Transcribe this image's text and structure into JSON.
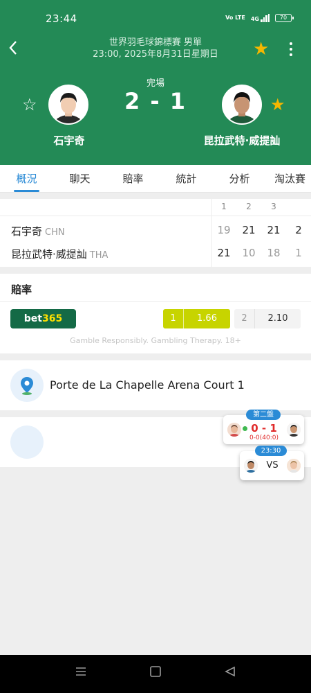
{
  "statusbar": {
    "time": "23:44",
    "net1": "Vo LTE",
    "net2": "4G",
    "battery": "70"
  },
  "header": {
    "competition": "世界羽毛球錦標賽 男單",
    "datetime": "23:00, 2025年8月31日星期日",
    "status": "完場",
    "score": "2 - 1",
    "player1": {
      "name": "石宇奇",
      "favorited": false
    },
    "player2": {
      "name": "昆拉武特·威提訕",
      "favorited": true
    },
    "match_favorited": true
  },
  "tabs": [
    "概況",
    "聊天",
    "賠率",
    "統計",
    "分析",
    "淘汰賽"
  ],
  "active_tab": 0,
  "scoreboard": {
    "set_headers": [
      "1",
      "2",
      "3"
    ],
    "rows": [
      {
        "name": "石宇奇",
        "country": "CHN",
        "sets": [
          "19",
          "21",
          "21"
        ],
        "total": "2"
      },
      {
        "name": "昆拉武特·威提訕",
        "country": "THA",
        "sets": [
          "21",
          "10",
          "18"
        ],
        "total": "1"
      }
    ]
  },
  "odds": {
    "title": "賠率",
    "bookmaker_a": "bet",
    "bookmaker_b": "365",
    "home_key": "1",
    "home_value": "1.66",
    "away_key": "2",
    "away_value": "2.10",
    "disclaimer": "Gamble Responsibly. Gambling Therapy. 18+"
  },
  "venue": {
    "name": "Porte de La Chapelle Arena Court 1"
  },
  "mini_live": {
    "tag": "第二盤",
    "score": "0 - 1",
    "sub": "0-0(40:0)"
  },
  "mini_upcoming": {
    "tag": "23:30",
    "vs": "VS"
  },
  "colors": {
    "header": "#238a56",
    "accent": "#2b8bd6",
    "odds_highlight": "#c7d400",
    "star": "#f5b700"
  },
  "icons": {
    "back": "chevron-left-icon",
    "star": "star-icon",
    "more": "more-vertical-icon",
    "venue": "location-pin-icon"
  }
}
